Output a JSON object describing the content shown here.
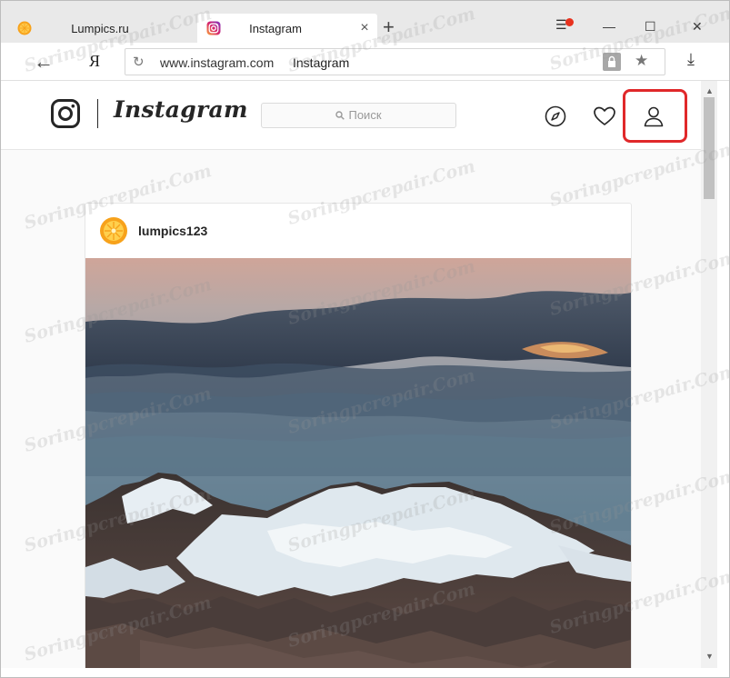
{
  "browser": {
    "tabs": [
      {
        "label": "Lumpics.ru"
      },
      {
        "label": "Instagram",
        "close": "×"
      }
    ],
    "new_tab": "+",
    "window_controls": {
      "menu": "☰",
      "minimize": "—",
      "maximize": "☐",
      "close": "✕"
    },
    "nav": {
      "back": "←",
      "yandex": "Я"
    },
    "address": {
      "reload": "↻",
      "url": "www.instagram.com",
      "page_title": "Instagram",
      "star": "★"
    },
    "download": "⤓"
  },
  "instagram": {
    "wordmark": "Instagram",
    "search_placeholder": "Поиск",
    "search_icon": "🔍",
    "icons": [
      "compass-icon",
      "heart-icon",
      "profile-icon"
    ],
    "highlight_color": "#e0282a"
  },
  "post": {
    "username": "lumpics123"
  },
  "watermark": {
    "text": "Soringpcrepair.Com"
  }
}
